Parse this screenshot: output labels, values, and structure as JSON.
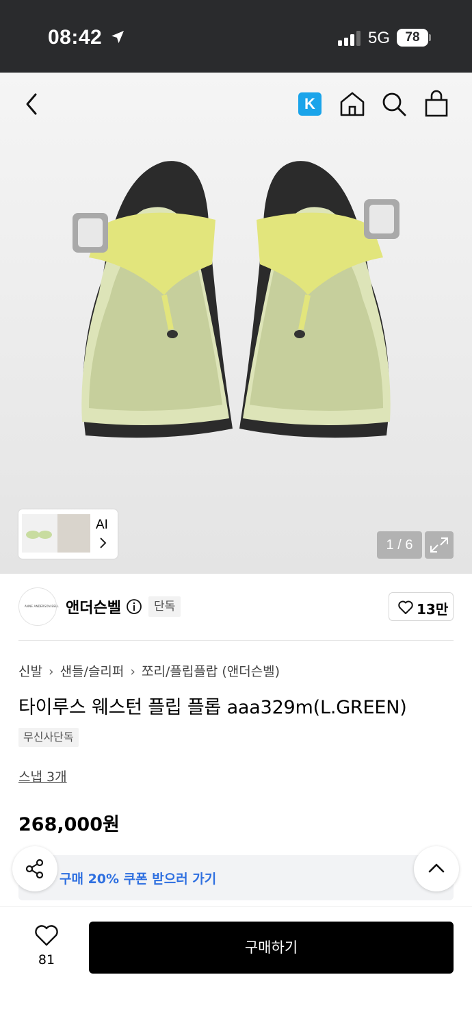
{
  "status_bar": {
    "time": "08:42",
    "network": "5G",
    "battery": "78"
  },
  "header": {
    "icons": [
      "back-icon",
      "k-icon",
      "home-icon",
      "search-icon",
      "bag-icon"
    ],
    "k_label": "K"
  },
  "gallery": {
    "ai_label": "AI",
    "counter": "1 / 6"
  },
  "brand": {
    "logo_text": "ANNE ANDERSON BELL",
    "name": "앤더슨벨",
    "badge": "단독",
    "likes": "13만"
  },
  "product": {
    "breadcrumb": [
      "신발",
      "샌들/슬리퍼",
      "쪼리/플립플랍 (앤더슨벨)"
    ],
    "title": "타이루스 웨스턴 플립 플롭 aaa329m(L.GREEN)",
    "tag": "무신사단독",
    "snap": "스냅 3개",
    "price": "268,000원"
  },
  "coupon": {
    "text": "구매 20% 쿠폰 받으러 가기"
  },
  "bottom_bar": {
    "wish_count": "81",
    "buy_label": "구매하기"
  },
  "colors": {
    "status_bg": "#2a2b2d",
    "coupon_text": "#2e6fe0",
    "k_brand": "#1aa4ea",
    "buy_bg": "#000000"
  }
}
